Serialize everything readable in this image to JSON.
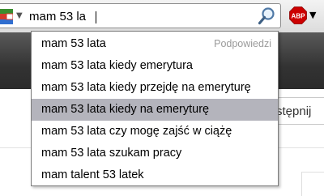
{
  "search": {
    "query": "mam 53 la",
    "engine_icon": "google-icon",
    "search_button_icon": "magnifier-icon"
  },
  "addon": {
    "label": "ABP",
    "color": "#cc0000"
  },
  "suggestions": {
    "hint": "Podpowiedzi",
    "items": [
      "mam 53 lata",
      "mam 53 lata kiedy emerytura",
      "mam 53 lata kiedy przejdę na emeryturę",
      "mam 53 lata kiedy na emeryturę",
      "mam 53 lata czy mogę zajść w ciążę",
      "mam 53 lata szukam pracy",
      "mam talent 53 latek"
    ],
    "selected_index": 3
  },
  "page": {
    "share_label": "stępnij"
  }
}
